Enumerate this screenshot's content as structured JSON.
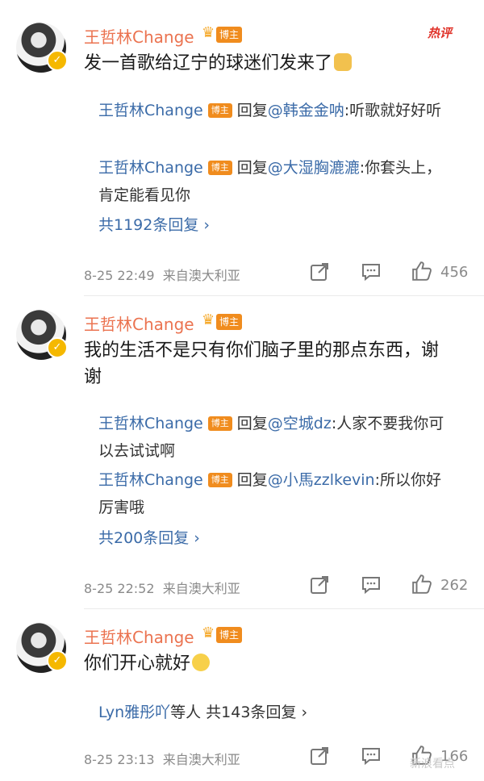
{
  "hot_label": "热评",
  "author": "王哲林Change",
  "badge": "博主",
  "reply_word": "回复",
  "comments": [
    {
      "text": "发一首歌给辽宁的球迷们发来了",
      "emoji": "cat-emoji",
      "replies": [
        {
          "target": "@韩金金呐",
          "content": ":听歌就好好听"
        },
        {
          "target": "@大湿胸漉漉",
          "content": ":你套头上，肯定能看见你"
        }
      ],
      "more": "共1192条回复 ›",
      "time": "8-25 22:49",
      "source": "来自澳大利亚",
      "likes": "456"
    },
    {
      "text": "我的生活不是只有你们脑子里的那点东西，谢谢",
      "replies": [
        {
          "target": "@空城dz",
          "content": ":人家不要我你可以去试试啊"
        },
        {
          "target": "@小馬zzlkevin",
          "content": ":所以你好厉害哦"
        }
      ],
      "more": "共200条回复 ›",
      "time": "8-25 22:52",
      "source": "来自澳大利亚",
      "likes": "262"
    },
    {
      "text": "你们开心就好",
      "emoji": "smile-emoji",
      "summary_name": "Lyn雅彤吖",
      "summary_rest": "等人 共143条回复 ›",
      "time": "8-25 23:13",
      "source": "来自澳大利亚",
      "likes": "166"
    }
  ],
  "watermark": "新浪看点"
}
